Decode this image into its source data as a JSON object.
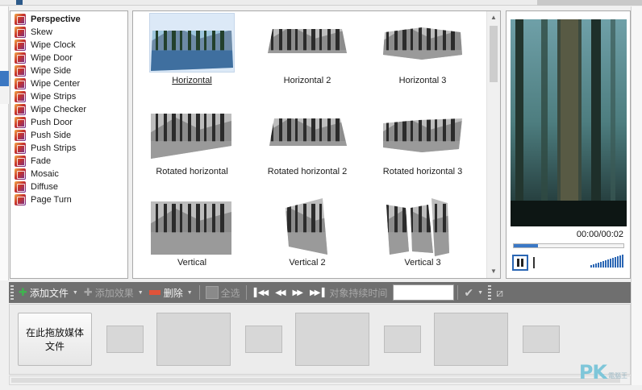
{
  "effects": {
    "items": [
      {
        "label": "Perspective",
        "selected": true
      },
      {
        "label": "Skew"
      },
      {
        "label": "Wipe Clock"
      },
      {
        "label": "Wipe Door"
      },
      {
        "label": "Wipe Side"
      },
      {
        "label": "Wipe Center"
      },
      {
        "label": "Wipe Strips"
      },
      {
        "label": "Wipe Checker"
      },
      {
        "label": "Push Door"
      },
      {
        "label": "Push Side"
      },
      {
        "label": "Push Strips"
      },
      {
        "label": "Fade"
      },
      {
        "label": "Mosaic"
      },
      {
        "label": "Diffuse"
      },
      {
        "label": "Page Turn"
      }
    ],
    "icon": "transition-effect-icon"
  },
  "gallery": {
    "thumbnails": [
      {
        "caption": "Horizontal",
        "selected": true,
        "shape": "horizontal"
      },
      {
        "caption": "Horizontal 2",
        "shape": "horizontal-2"
      },
      {
        "caption": "Horizontal 3",
        "shape": "horizontal-3"
      },
      {
        "caption": "Rotated horizontal",
        "shape": "rot-horizontal"
      },
      {
        "caption": "Rotated horizontal 2",
        "shape": "rot-horizontal-2"
      },
      {
        "caption": "Rotated horizontal 3",
        "shape": "rot-horizontal-3"
      },
      {
        "caption": "Vertical",
        "shape": "vertical"
      },
      {
        "caption": "Vertical 2",
        "shape": "vertical-2"
      },
      {
        "caption": "Vertical 3",
        "shape": "vertical-3"
      }
    ]
  },
  "preview": {
    "time": "00:00/00:02",
    "progress": 0.22,
    "volume_level": 1.0
  },
  "toolbar": {
    "add_file": "添加文件",
    "add_effect": "添加效果",
    "delete": "删除",
    "select_all": "全选",
    "duration_label": "对象持续时间",
    "duration_value": ""
  },
  "timeline": {
    "drop_label": "在此拖放媒体文件"
  },
  "watermark": {
    "text": "PK",
    "sub": "電腦王"
  },
  "colors": {
    "accent": "#2a66b4",
    "toolbar_bg": "#6f6f6f",
    "add_icon": "#3fb34f",
    "delete_icon": "#e0533a"
  }
}
